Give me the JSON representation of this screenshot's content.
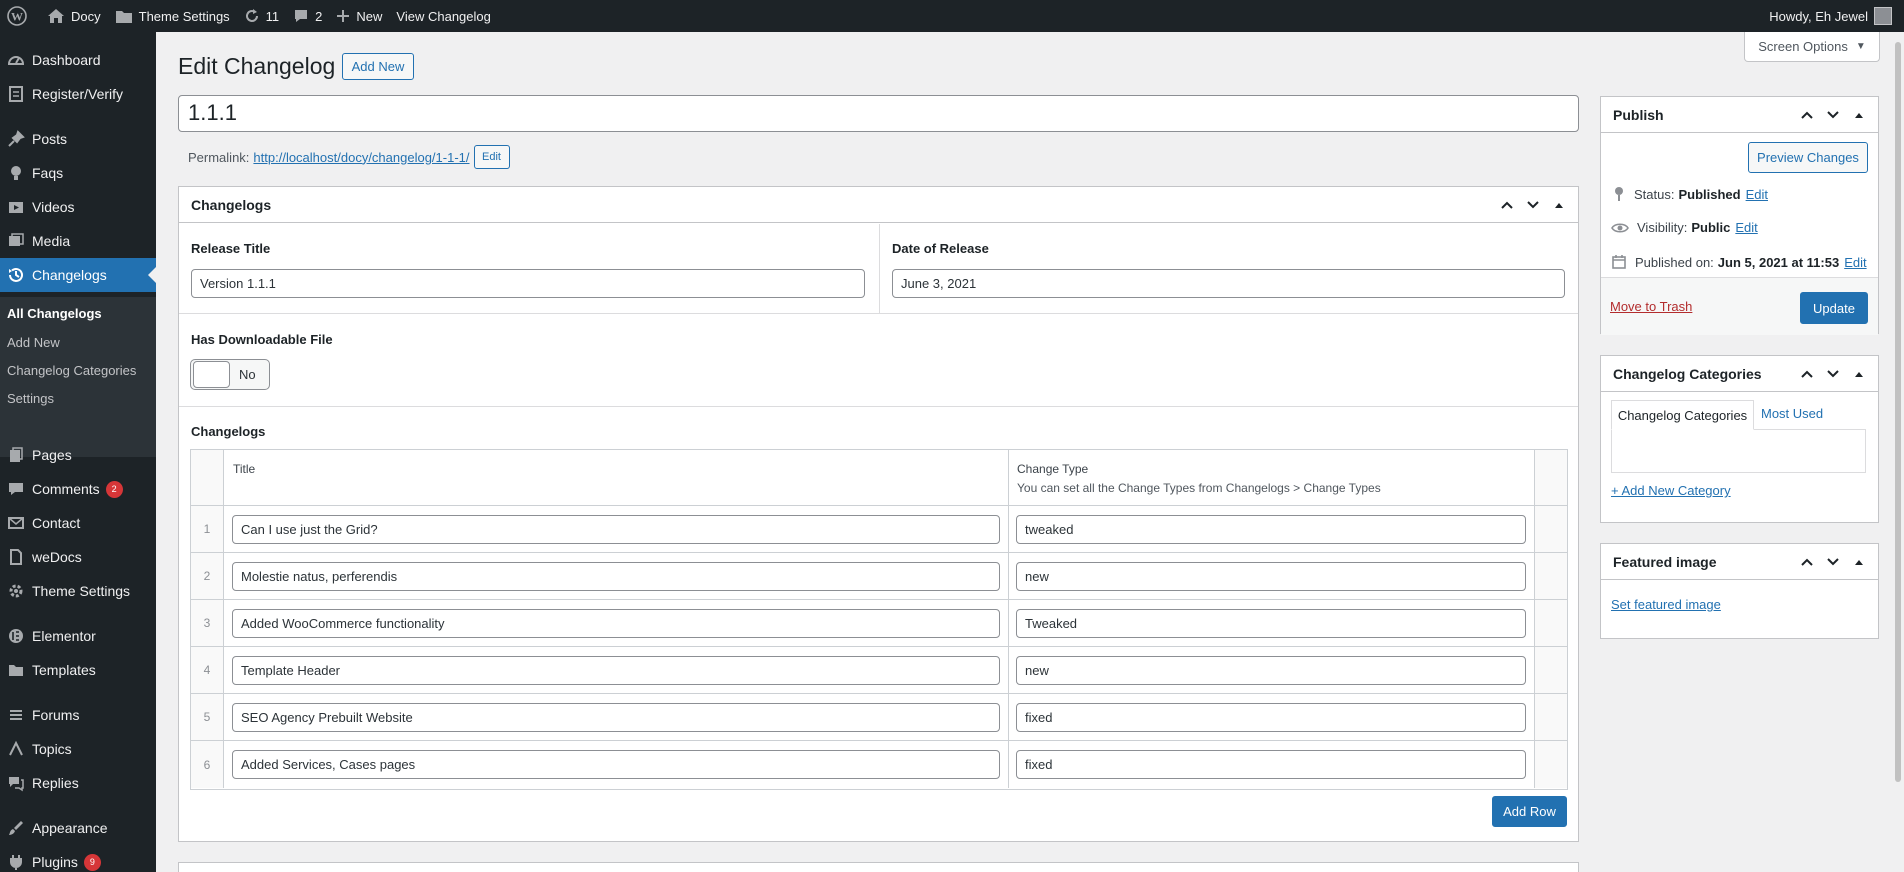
{
  "admin_bar": {
    "site_name": "Docy",
    "theme_settings": "Theme Settings",
    "updates_count": "11",
    "comments_count": "2",
    "new_label": "New",
    "view_label": "View Changelog",
    "greeting": "Howdy, Eh Jewel"
  },
  "sidebar": {
    "items": [
      {
        "label": "Dashboard",
        "icon": "dashboard-icon"
      },
      {
        "label": "Register/Verify",
        "icon": "register-icon"
      },
      {
        "label": "Posts",
        "icon": "pin-icon"
      },
      {
        "label": "Faqs",
        "icon": "lightbulb-icon"
      },
      {
        "label": "Videos",
        "icon": "video-icon"
      },
      {
        "label": "Media",
        "icon": "media-icon"
      },
      {
        "label": "Changelogs",
        "icon": "history-icon"
      },
      {
        "label": "Pages",
        "icon": "pages-icon"
      },
      {
        "label": "Comments",
        "icon": "comment-icon",
        "badge": "2"
      },
      {
        "label": "Contact",
        "icon": "mail-icon"
      },
      {
        "label": "weDocs",
        "icon": "doc-icon"
      },
      {
        "label": "Theme Settings",
        "icon": "gear-icon"
      },
      {
        "label": "Elementor",
        "icon": "elementor-icon"
      },
      {
        "label": "Templates",
        "icon": "folder-icon"
      },
      {
        "label": "Forums",
        "icon": "forums-icon"
      },
      {
        "label": "Topics",
        "icon": "topics-icon"
      },
      {
        "label": "Replies",
        "icon": "replies-icon"
      },
      {
        "label": "Appearance",
        "icon": "brush-icon"
      },
      {
        "label": "Plugins",
        "icon": "plugin-icon",
        "badge": "9"
      }
    ],
    "submenu": [
      "All Changelogs",
      "Add New",
      "Changelog Categories",
      "Settings"
    ]
  },
  "page": {
    "title": "Edit Changelog",
    "add_new": "Add New",
    "screen_options": "Screen Options",
    "post_title": "1.1.1",
    "permalink_label": "Permalink:",
    "permalink_url": "http://localhost/docy/changelog/1-1-1/",
    "permalink_edit": "Edit"
  },
  "changelogs_box": {
    "title": "Changelogs",
    "release_title_label": "Release Title",
    "release_title_value": "Version 1.1.1",
    "date_label": "Date of Release",
    "date_value": "June 3, 2021",
    "downloadable_label": "Has Downloadable File",
    "downloadable_value": "No",
    "list_label": "Changelogs",
    "col_title": "Title",
    "col_type": "Change Type",
    "col_type_hint": "You can set all the Change Types from Changelogs > Change Types",
    "rows": [
      {
        "num": "1",
        "title": "Can I use just the Grid?",
        "type": "tweaked"
      },
      {
        "num": "2",
        "title": "Molestie natus, perferendis",
        "type": "new"
      },
      {
        "num": "3",
        "title": "Added WooCommerce functionality",
        "type": "Tweaked"
      },
      {
        "num": "4",
        "title": "Template Header",
        "type": "new"
      },
      {
        "num": "5",
        "title": "SEO Agency Prebuilt Website",
        "type": "fixed"
      },
      {
        "num": "6",
        "title": "Added Services, Cases pages",
        "type": "fixed"
      }
    ],
    "add_row": "Add Row"
  },
  "publish": {
    "title": "Publish",
    "preview": "Preview Changes",
    "status_label": "Status:",
    "status_value": "Published",
    "visibility_label": "Visibility:",
    "visibility_value": "Public",
    "published_label": "Published on:",
    "published_value": "Jun 5, 2021 at 11:53",
    "edit": "Edit",
    "trash": "Move to Trash",
    "update": "Update"
  },
  "categories": {
    "title": "Changelog Categories",
    "tab_all": "Changelog Categories",
    "tab_used": "Most Used",
    "add_new": "+ Add New Category"
  },
  "featured": {
    "title": "Featured image",
    "set": "Set featured image"
  },
  "colors": {
    "admin_dark": "#1d2327",
    "accent": "#2271b1",
    "badge": "#d63638"
  }
}
